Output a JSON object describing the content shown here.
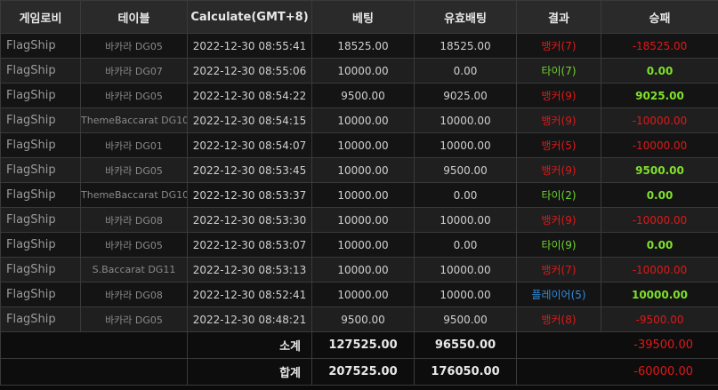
{
  "headers": [
    "게임로비",
    "테이블",
    "Calculate(GMT+8)",
    "베팅",
    "유효배팅",
    "결과",
    "승패"
  ],
  "rows": [
    {
      "lobby": "FlagShip",
      "table": "바카라 DG05",
      "time": "2022-12-30 08:55:41",
      "bet": "18525.00",
      "valid": "18525.00",
      "result": "뱅커(7)",
      "result_type": "banker",
      "winloss": "-18525.00",
      "wl_type": "neg"
    },
    {
      "lobby": "FlagShip",
      "table": "바카라 DG07",
      "time": "2022-12-30 08:55:06",
      "bet": "10000.00",
      "valid": "0.00",
      "result": "타이(7)",
      "result_type": "tie",
      "winloss": "0.00",
      "wl_type": "zero"
    },
    {
      "lobby": "FlagShip",
      "table": "바카라 DG05",
      "time": "2022-12-30 08:54:22",
      "bet": "9500.00",
      "valid": "9025.00",
      "result": "뱅커(9)",
      "result_type": "banker",
      "winloss": "9025.00",
      "wl_type": "pos"
    },
    {
      "lobby": "FlagShip",
      "table": "ThemeBaccarat DG10",
      "time": "2022-12-30 08:54:15",
      "bet": "10000.00",
      "valid": "10000.00",
      "result": "뱅커(9)",
      "result_type": "banker",
      "winloss": "-10000.00",
      "wl_type": "neg"
    },
    {
      "lobby": "FlagShip",
      "table": "바카라 DG01",
      "time": "2022-12-30 08:54:07",
      "bet": "10000.00",
      "valid": "10000.00",
      "result": "뱅커(5)",
      "result_type": "banker",
      "winloss": "-10000.00",
      "wl_type": "neg"
    },
    {
      "lobby": "FlagShip",
      "table": "바카라 DG05",
      "time": "2022-12-30 08:53:45",
      "bet": "10000.00",
      "valid": "9500.00",
      "result": "뱅커(9)",
      "result_type": "banker",
      "winloss": "9500.00",
      "wl_type": "pos"
    },
    {
      "lobby": "FlagShip",
      "table": "ThemeBaccarat DG10",
      "time": "2022-12-30 08:53:37",
      "bet": "10000.00",
      "valid": "0.00",
      "result": "타이(2)",
      "result_type": "tie",
      "winloss": "0.00",
      "wl_type": "zero"
    },
    {
      "lobby": "FlagShip",
      "table": "바카라 DG08",
      "time": "2022-12-30 08:53:30",
      "bet": "10000.00",
      "valid": "10000.00",
      "result": "뱅커(9)",
      "result_type": "banker",
      "winloss": "-10000.00",
      "wl_type": "neg"
    },
    {
      "lobby": "FlagShip",
      "table": "바카라 DG05",
      "time": "2022-12-30 08:53:07",
      "bet": "10000.00",
      "valid": "0.00",
      "result": "타이(9)",
      "result_type": "tie",
      "winloss": "0.00",
      "wl_type": "zero"
    },
    {
      "lobby": "FlagShip",
      "table": "S.Baccarat DG11",
      "time": "2022-12-30 08:53:13",
      "bet": "10000.00",
      "valid": "10000.00",
      "result": "뱅커(7)",
      "result_type": "banker",
      "winloss": "-10000.00",
      "wl_type": "neg"
    },
    {
      "lobby": "FlagShip",
      "table": "바카라 DG08",
      "time": "2022-12-30 08:52:41",
      "bet": "10000.00",
      "valid": "10000.00",
      "result": "플레이어(5)",
      "result_type": "player",
      "winloss": "10000.00",
      "wl_type": "pos"
    },
    {
      "lobby": "FlagShip",
      "table": "바카라 DG05",
      "time": "2022-12-30 08:48:21",
      "bet": "9500.00",
      "valid": "9500.00",
      "result": "뱅커(8)",
      "result_type": "banker",
      "winloss": "-9500.00",
      "wl_type": "neg"
    }
  ],
  "subtotal": {
    "label": "소계",
    "bet": "127525.00",
    "valid": "96550.00",
    "winloss": "-39500.00"
  },
  "total": {
    "label": "합계",
    "bet": "207525.00",
    "valid": "176050.00",
    "winloss": "-60000.00"
  },
  "colors": {
    "banker": "#e01818",
    "tie": "#6fd42a",
    "player": "#2f8de0",
    "negative": "#e01818",
    "positive": "#7fe12a"
  }
}
